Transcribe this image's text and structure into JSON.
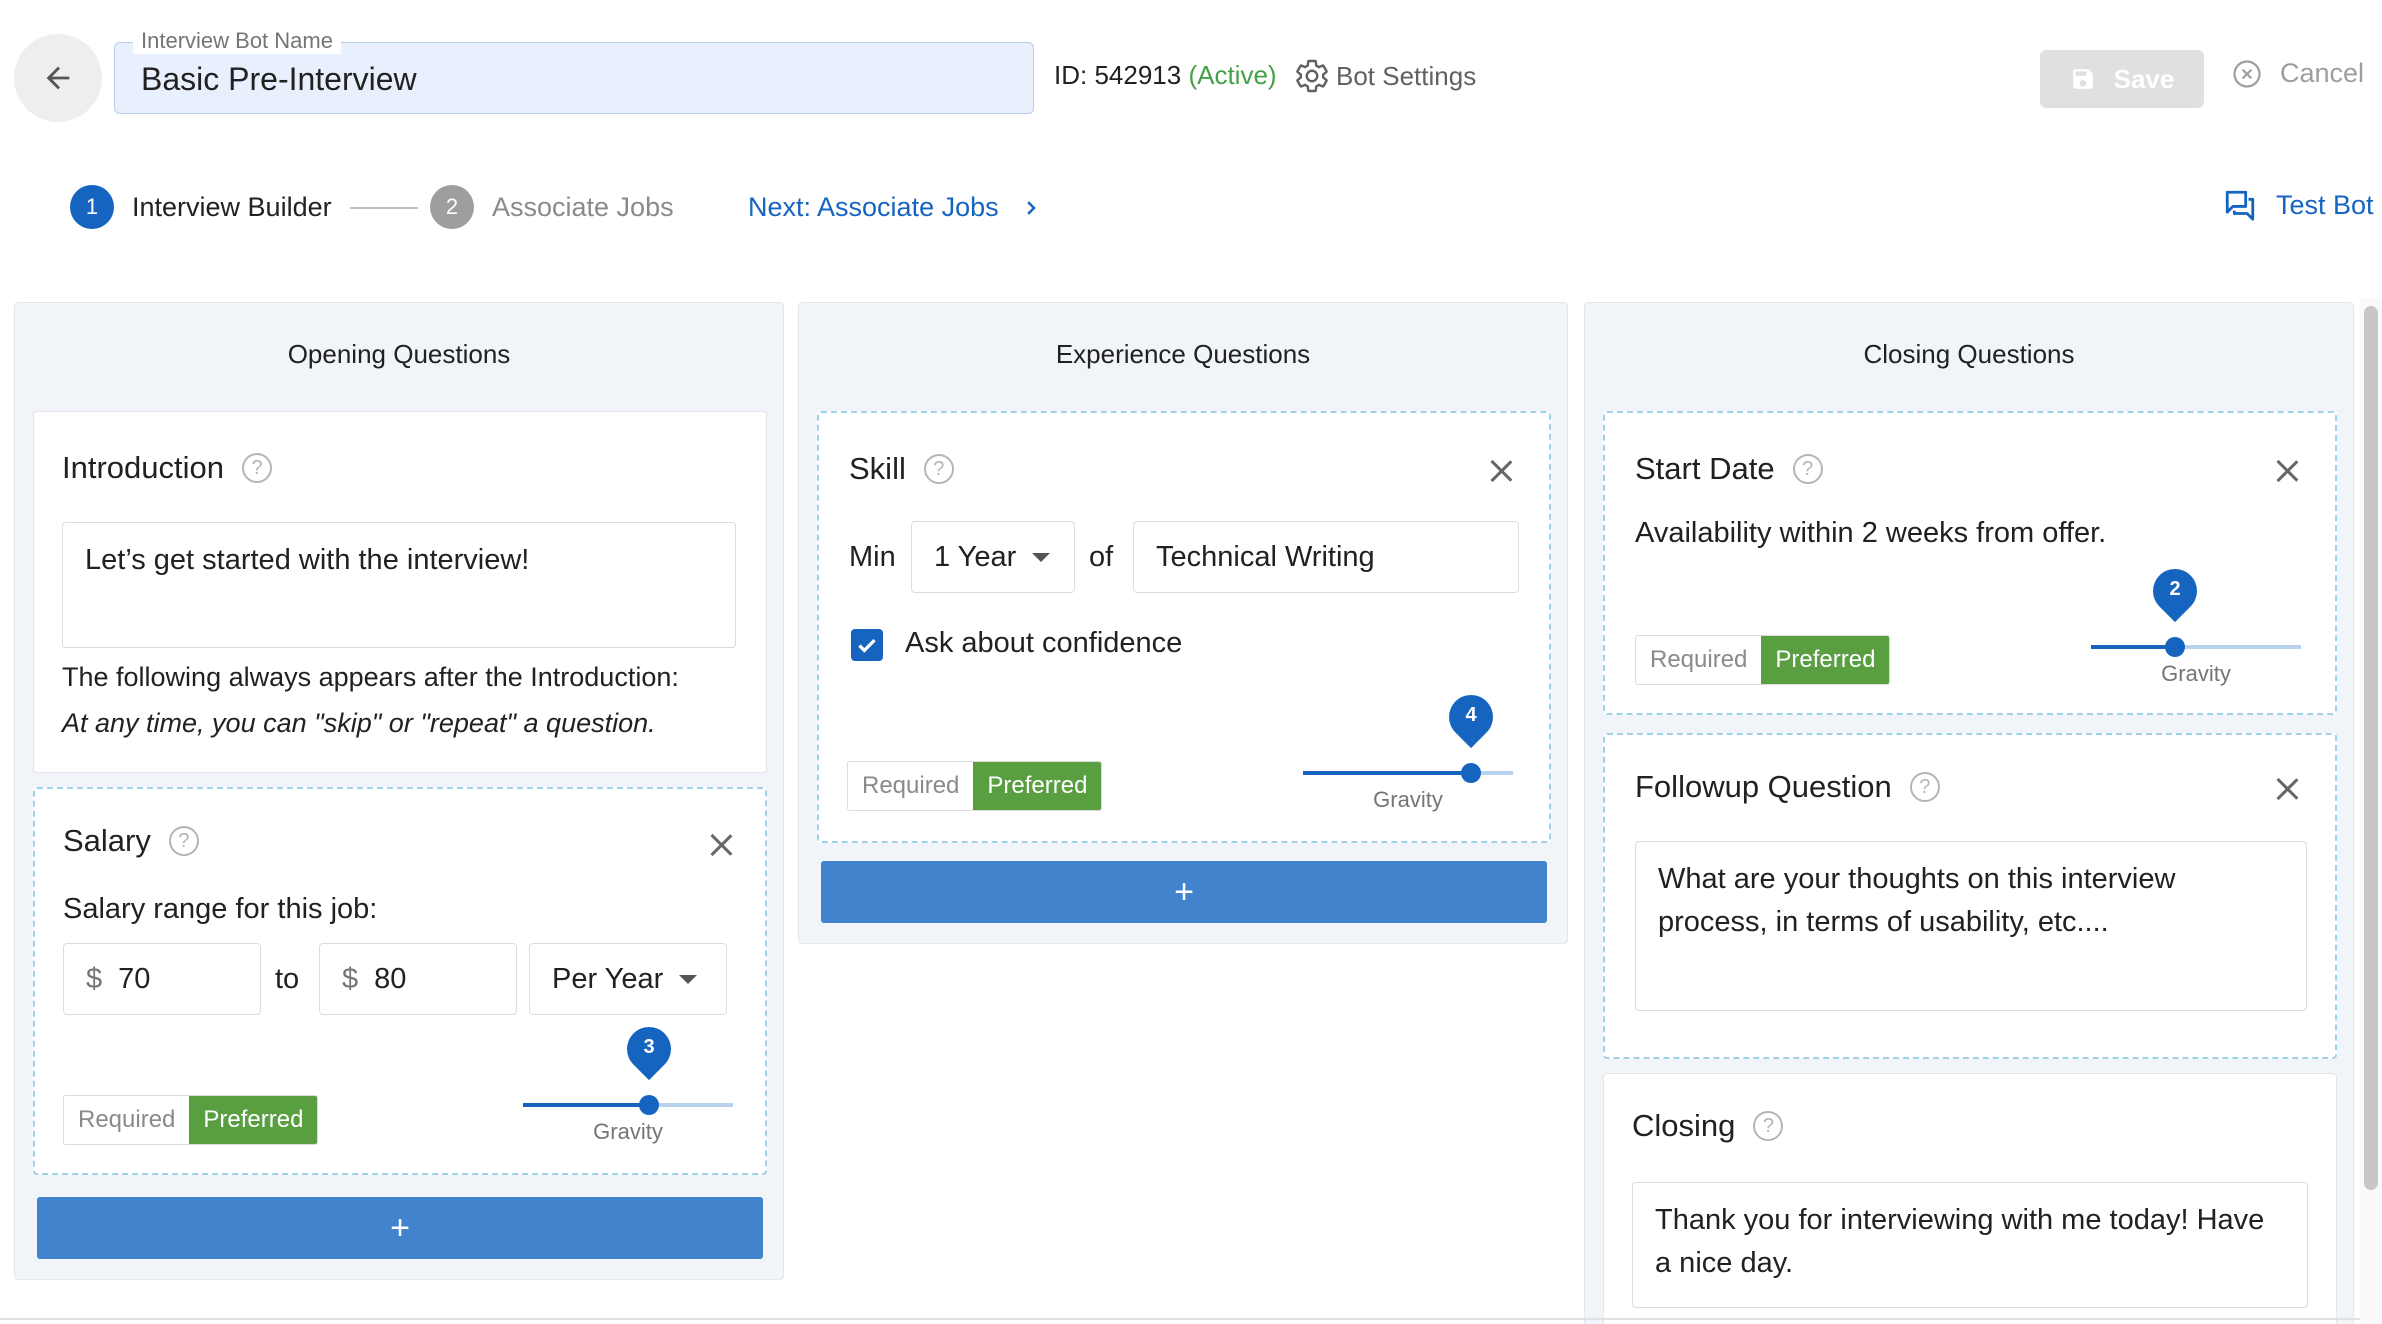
{
  "header": {
    "name_field_label": "Interview Bot Name",
    "name_field_value": "Basic Pre-Interview",
    "id_text": "ID: 542913",
    "status_text": "(Active)",
    "bot_settings_label": "Bot Settings",
    "save_label": "Save",
    "cancel_label": "Cancel"
  },
  "stepper": {
    "steps": [
      {
        "number": "1",
        "label": "Interview Builder",
        "state": "active"
      },
      {
        "number": "2",
        "label": "Associate Jobs",
        "state": "inactive"
      }
    ],
    "next_label": "Next: Associate Jobs",
    "test_bot_label": "Test Bot"
  },
  "columns": {
    "opening": {
      "title": "Opening Questions",
      "introduction": {
        "title": "Introduction",
        "text": "Let’s get started with the interview!",
        "note": "The following always appears after the Introduction:",
        "note_italic": "At any time, you can \"skip\" or \"repeat\" a question."
      },
      "salary": {
        "title": "Salary",
        "prompt": "Salary range for this job:",
        "currency": "$",
        "min_value": "70",
        "to_label": "to",
        "max_value": "80",
        "period": "Per Year",
        "required_label": "Required",
        "preferred_label": "Preferred",
        "selected": "Preferred",
        "gravity_value": "3",
        "gravity_fraction": 0.6,
        "gravity_label": "Gravity"
      },
      "add_label": "+"
    },
    "experience": {
      "title": "Experience Questions",
      "skill": {
        "title": "Skill",
        "min_label": "Min",
        "years_value": "1 Year",
        "of_label": "of",
        "skill_value": "Technical Writing",
        "ask_confidence_label": "Ask about confidence",
        "ask_confidence_checked": true,
        "required_label": "Required",
        "preferred_label": "Preferred",
        "selected": "Preferred",
        "gravity_value": "4",
        "gravity_fraction": 0.8,
        "gravity_label": "Gravity"
      },
      "add_label": "+"
    },
    "closing": {
      "title": "Closing Questions",
      "start_date": {
        "title": "Start Date",
        "text": "Availability within 2 weeks from offer.",
        "required_label": "Required",
        "preferred_label": "Preferred",
        "selected": "Preferred",
        "gravity_value": "2",
        "gravity_fraction": 0.4,
        "gravity_label": "Gravity"
      },
      "followup": {
        "title": "Followup Question",
        "text": "What are your thoughts on this interview process, in terms of usability, etc...."
      },
      "closing": {
        "title": "Closing",
        "text": "Thank you for interviewing with me today! Have a nice day."
      }
    }
  },
  "colors": {
    "primary": "#1565c0",
    "active_status": "#43a047",
    "preferred_bg": "#5a9e42",
    "add_button": "#4183cc",
    "name_field_bg": "#e8f0fe"
  }
}
